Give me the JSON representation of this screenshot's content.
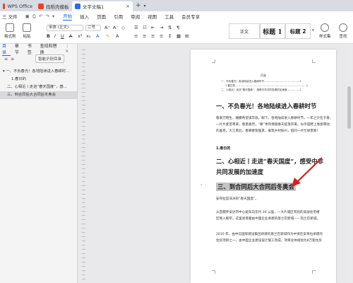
{
  "tabs": [
    {
      "label": "WPS Office",
      "color": "#e34234"
    },
    {
      "label": "找稻壳模板",
      "color": "#e34234"
    },
    {
      "label": "文字文稿1",
      "color": "#2b6ce6"
    }
  ],
  "menu": {
    "file": "三 文件",
    "items": [
      "开始",
      "插入",
      "页面",
      "引用",
      "审阅",
      "视图",
      "工具",
      "会员专享"
    ],
    "active": "开始"
  },
  "ribbon": {
    "format_painter": "格式刷",
    "paste": "粘贴",
    "font_name": "宋体 (正文)",
    "font_size": "二号",
    "styles": {
      "body": "正文",
      "h1": "标题 1",
      "h2": "标题 2"
    },
    "style_set": "样式集",
    "find": "查找"
  },
  "nav": {
    "tabs": [
      "目录",
      "章节",
      "书签",
      "查找和替换"
    ],
    "smart_toc": "智能识别目录",
    "toc": [
      {
        "text": "一、不负春光！各地陆续进入春耕时...",
        "level": 1
      },
      {
        "text": "1.春日的",
        "level": 2
      },
      {
        "text": "二、心相近丨走进“春天国度”，感...",
        "level": 1
      },
      {
        "text": "三、到合同后大合同后冬奥会",
        "level": 1
      }
    ]
  },
  "doc": {
    "toc_heading": "目录",
    "toc_lines": [
      "一、不负春光！各地陆续进入春耕时节……………………………………1",
      "1.春日的…………………………………………………………………………1",
      "二、心相近丨走进“春天国度”，感受中非共同发展的加速度……………1"
    ],
    "h_one": "一、不负春光！各地陆续进入春耕时节",
    "p_one": [
      "春来万物生，播撒希望谋丰收。眼下，各地陆续进入春耕时节，一年之计在于春，",
      "一片片麦苗青翠，春意盎然，“耕”季热情随春天绽放开来。似乎田野上春意萌动",
      "的画卷，大江南北，春耕春管图景，展现乡村振兴，田间一片忙碌景象！"
    ],
    "sub_one": "1.春日的",
    "h_two_a": "二、心相近丨走进“春天国度”，感受中非",
    "h_two_b": "共同发展的加速度",
    "h_three": "三、到合同后大合同后冬奥会",
    "p_three_a": "安哥拉是非洲的“春天国度”。",
    "p_three_b": [
      "从首都罗安达市中心驱车向东约 16 公里，一大片城区有别的高层住宅楼",
      "区映入眼帘，这里坐落着由中国企业承建的基兰巴新城——凯兰巴新城。"
    ],
    "p_three_c": [
      "2010 年，由中信国际建设集团承建的基兰巴新城作为中资在安哥拉承建的",
      "住房项目之一，由中国企业建设设计施工完成，项目总体规划为8万套住房"
    ]
  }
}
